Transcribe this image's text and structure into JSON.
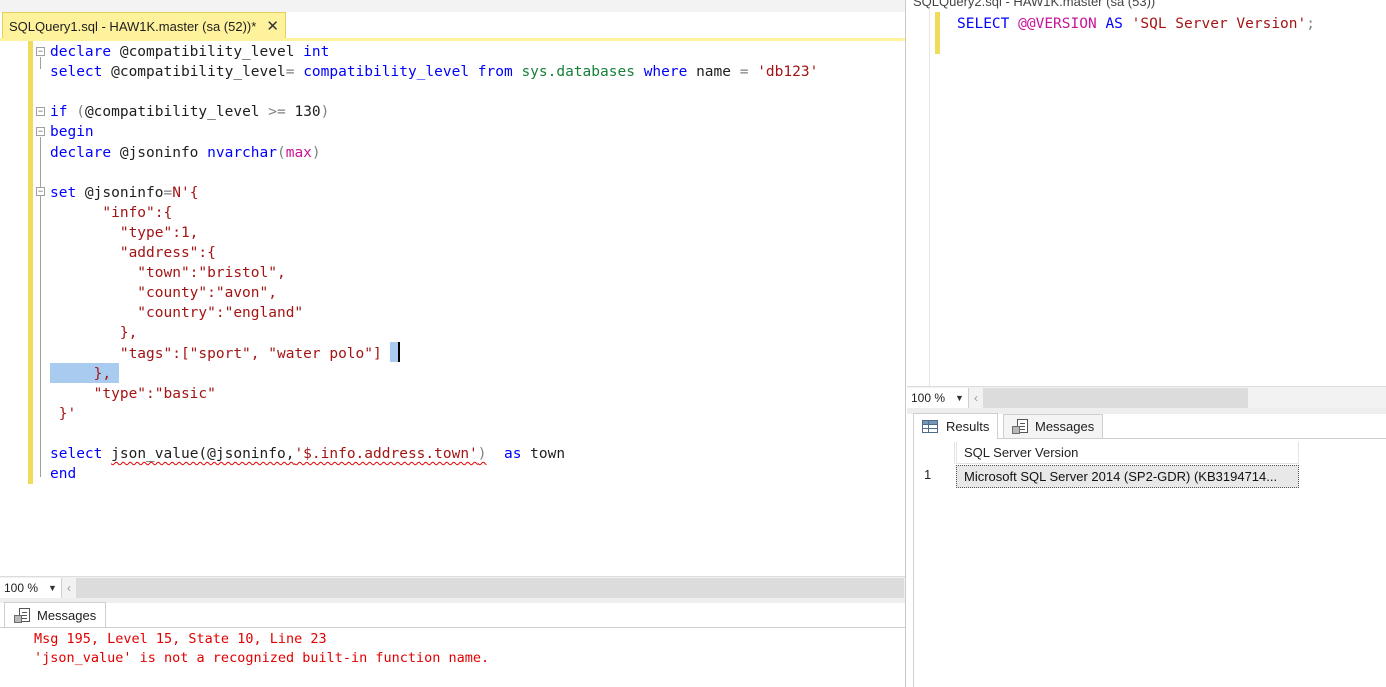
{
  "left_pane": {
    "tab": {
      "title": "SQLQuery1.sql - HAW1K.master (sa (52))*",
      "close_glyph": "✕"
    },
    "code_lines": [
      [
        {
          "t": "declare",
          "c": "kw"
        },
        {
          "t": " @compatibility_level ",
          "c": ""
        },
        {
          "t": "int",
          "c": "kw"
        }
      ],
      [
        {
          "t": "select",
          "c": "kw"
        },
        {
          "t": " @compatibility_level",
          "c": ""
        },
        {
          "t": "=",
          "c": "op"
        },
        {
          "t": " ",
          "c": ""
        },
        {
          "t": "compatibility_level",
          "c": "kw"
        },
        {
          "t": " ",
          "c": ""
        },
        {
          "t": "from",
          "c": "kw"
        },
        {
          "t": " ",
          "c": ""
        },
        {
          "t": "sys.databases",
          "c": "sys"
        },
        {
          "t": " ",
          "c": ""
        },
        {
          "t": "where",
          "c": "kw"
        },
        {
          "t": " name ",
          "c": ""
        },
        {
          "t": "=",
          "c": "op"
        },
        {
          "t": " ",
          "c": ""
        },
        {
          "t": "'db123'",
          "c": "str"
        }
      ],
      [],
      [
        {
          "t": "if",
          "c": "kw"
        },
        {
          "t": " ",
          "c": ""
        },
        {
          "t": "(",
          "c": "op"
        },
        {
          "t": "@compatibility_level ",
          "c": ""
        },
        {
          "t": ">=",
          "c": "op"
        },
        {
          "t": " 130",
          "c": ""
        },
        {
          "t": ")",
          "c": "op"
        }
      ],
      [
        {
          "t": "begin",
          "c": "kw"
        }
      ],
      [
        {
          "t": "declare",
          "c": "kw"
        },
        {
          "t": " @jsoninfo ",
          "c": ""
        },
        {
          "t": "nvarchar",
          "c": "kw"
        },
        {
          "t": "(",
          "c": "op"
        },
        {
          "t": "max",
          "c": "fn"
        },
        {
          "t": ")",
          "c": "op"
        }
      ],
      [],
      [
        {
          "t": "set",
          "c": "kw"
        },
        {
          "t": " @jsoninfo",
          "c": ""
        },
        {
          "t": "=",
          "c": "op"
        },
        {
          "t": "N'{",
          "c": "str"
        }
      ],
      [
        {
          "t": "      \"info\":{",
          "c": "str"
        }
      ],
      [
        {
          "t": "        \"type\":1,",
          "c": "str"
        }
      ],
      [
        {
          "t": "        \"address\":{",
          "c": "str"
        }
      ],
      [
        {
          "t": "          \"town\":\"bristol\",",
          "c": "str"
        }
      ],
      [
        {
          "t": "          \"county\":\"avon\",",
          "c": "str"
        }
      ],
      [
        {
          "t": "          \"country\":\"england\"",
          "c": "str"
        }
      ],
      [
        {
          "t": "        },",
          "c": "str"
        }
      ],
      [
        {
          "t": "        \"tags\":[\"sport\", \"water polo\"]",
          "c": "str"
        }
      ],
      [
        {
          "t": "     },",
          "c": "str"
        }
      ],
      [
        {
          "t": "     \"type\":\"basic\"",
          "c": "str"
        }
      ],
      [
        {
          "t": " }'",
          "c": "str"
        }
      ],
      [],
      [
        {
          "t": "select",
          "c": "kw"
        },
        {
          "t": " ",
          "c": ""
        },
        {
          "t": "json_value(@jsoninfo,",
          "c": "sq"
        },
        {
          "t": "'$.info.address.town'",
          "c": "str sq"
        },
        {
          "t": ")",
          "c": "op sq"
        },
        {
          "t": "  ",
          "c": ""
        },
        {
          "t": "as",
          "c": "kw"
        },
        {
          "t": " town",
          "c": ""
        }
      ],
      [
        {
          "t": "end",
          "c": "kw"
        }
      ]
    ],
    "zoom": {
      "value": "100 %",
      "dropdown_glyph": "▼",
      "scroll_left_glyph": "‹"
    },
    "messages_tab": {
      "label": "Messages"
    },
    "messages": [
      "Msg 195, Level 15, State 10, Line 23",
      "'json_value' is not a recognized built-in function name."
    ]
  },
  "right_pane": {
    "tab_title": "SQLQuery2.sql - HAW1K.master (sa (53))",
    "code": [
      {
        "t": "SELECT",
        "c": "kw"
      },
      {
        "t": " ",
        "c": ""
      },
      {
        "t": "@@VERSION",
        "c": "fn"
      },
      {
        "t": " ",
        "c": ""
      },
      {
        "t": "AS",
        "c": "kw"
      },
      {
        "t": " ",
        "c": ""
      },
      {
        "t": "'SQL Server Version'",
        "c": "str"
      },
      {
        "t": ";",
        "c": "op"
      }
    ],
    "zoom": {
      "value": "100 %",
      "dropdown_glyph": "▼",
      "scroll_left_glyph": "‹"
    },
    "tabs": {
      "results": "Results",
      "messages": "Messages"
    },
    "grid": {
      "column_header": "SQL Server Version",
      "rows": [
        {
          "num": "1",
          "value": "Microsoft SQL Server 2014 (SP2-GDR) (KB3194714..."
        }
      ]
    }
  },
  "colors": {
    "keyword": "#0000ff",
    "string": "#a31515",
    "function": "#c8139a",
    "system_object": "#18803a",
    "operator": "#808080",
    "error_message": "#e00000",
    "active_tab": "#fff29d",
    "selection": "#a8cbef"
  },
  "icons": {
    "messages_tab_icon": "messages-icon",
    "results_tab_icon": "grid-icon"
  }
}
